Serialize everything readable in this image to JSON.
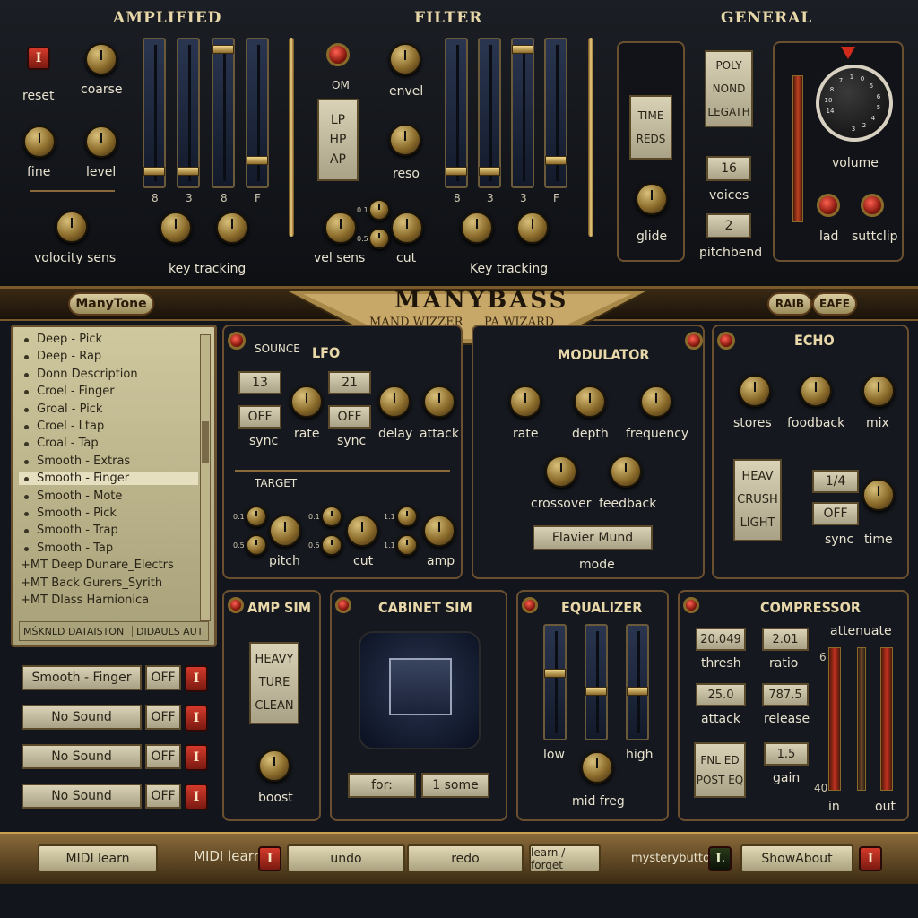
{
  "headers": {
    "amplified": "AMPLIFIED",
    "filter": "FILTER",
    "general": "GENERAL"
  },
  "amplified": {
    "reset": "reset",
    "coarse": "coarse",
    "fine": "fine",
    "level": "level",
    "velocity": "volocity sens",
    "keytracking": "key tracking",
    "s_labels": [
      "8",
      "3",
      "8",
      "F"
    ]
  },
  "filter": {
    "om": "OM",
    "types": [
      "LP",
      "HP",
      "AP"
    ],
    "envel": "envel",
    "reso": "reso",
    "velsens": "vel sens",
    "cut": "cut",
    "keytracking": "Key tracking",
    "s_labels": [
      "8",
      "3",
      "3",
      "F"
    ],
    "mini": [
      "0.1",
      "0.5"
    ]
  },
  "general": {
    "time": "TIME",
    "reds": "REDS",
    "glide": "glide",
    "modes": [
      "POLY",
      "NOND",
      "LEGATH"
    ],
    "voices": "16",
    "voices_label": "voices",
    "pitchbend": "2",
    "pitchbend_label": "pitchbend",
    "volume": "volume",
    "lad": "lad",
    "suttclip": "suttclip",
    "dial_numbers": [
      "14",
      "10",
      "8",
      "7",
      "1",
      "0",
      "5",
      "6",
      "5",
      "4",
      "2",
      "3"
    ]
  },
  "brand": {
    "title": "MANYBASS",
    "sub1": "MAND WIZZER",
    "sub2": "PA WIZARD",
    "left": "ManyTone",
    "right1": "RAIB",
    "right2": "EAFE"
  },
  "presets": {
    "items": [
      "Deep - Pick",
      "Deep - Rap",
      "Donn Description",
      "Croel - Finger",
      "Groal - Pick",
      "Croel - Ltap",
      "Croal - Tap",
      "Smooth - Extras",
      "Smooth - Finger",
      "Smooth - Mote",
      "Smooth - Pick",
      "Smooth - Trap",
      "Smooth - Tap"
    ],
    "folders": [
      "MT Deep Dunare_Electrs",
      "MT Back Gurers_Syrith",
      "MT Dlass Harnionica"
    ],
    "footer_left": "MŚKNLD DATAISTON",
    "footer_right": "DIDAULS AUT"
  },
  "slots": [
    {
      "name": "Smooth - Finger",
      "state": "OFF"
    },
    {
      "name": "No Sound",
      "state": "OFF"
    },
    {
      "name": "No Sound",
      "state": "OFF"
    },
    {
      "name": "No Sound",
      "state": "OFF"
    }
  ],
  "lfo": {
    "sounce": "SOUNCE",
    "title": "LFO",
    "rate_val": "13",
    "sync_val": "OFF",
    "rate": "rate",
    "sync": "sync",
    "delay_val": "21",
    "sync2_val": "OFF",
    "sync2": "sync",
    "delay": "delay",
    "attack": "attack",
    "target": "TARGET",
    "pitch": "pitch",
    "cut": "cut",
    "amp": "amp",
    "minis": [
      "0.1",
      "0.5",
      "0.1",
      "0.5",
      "1.1",
      "1.1"
    ]
  },
  "modulator": {
    "title": "MODULATOR",
    "rate": "rate",
    "depth": "depth",
    "frequency": "frequency",
    "crossover": "crossover",
    "feedback": "feedback",
    "mode_val": "Flavier Mund",
    "mode": "mode"
  },
  "echo": {
    "title": "ECHO",
    "stores": "stores",
    "foodback": "foodback",
    "mix": "mix",
    "types": [
      "HEAV",
      "CRUSH",
      "LIGHT"
    ],
    "time_val": "1/4",
    "sync_val": "OFF",
    "sync": "sync",
    "time": "time"
  },
  "ampsim": {
    "title": "AMP SIM",
    "types": [
      "HEAVY",
      "TURE",
      "CLEAN"
    ],
    "boost": "boost"
  },
  "cabinet": {
    "title": "CABINET SIM",
    "for": "for:",
    "some": "1 some"
  },
  "equalizer": {
    "title": "EQUALIZER",
    "low": "low",
    "high": "high",
    "mid": "mid freg"
  },
  "compressor": {
    "title": "COMPRESSOR",
    "thresh_val": "20.049",
    "thresh": "thresh",
    "ratio_val": "2.01",
    "ratio": "ratio",
    "attenuate": "attenuate",
    "attack_val": "25.0",
    "attack": "attack",
    "release_val": "787.5",
    "release": "release",
    "fnl": "FNL ED",
    "post": "POST EQ",
    "gain_val": "1.5",
    "gain": "gain",
    "top": "6",
    "bottom": "40",
    "in": "in",
    "out": "out"
  },
  "bottom": {
    "midi1": "MIDI learn",
    "midi2": "MIDI learn",
    "undo": "undo",
    "redo": "redo",
    "learn": "learn / forget",
    "mystery": "mysterybutton",
    "mystery_badge": "L",
    "about": "ShowAbout",
    "badge": "I"
  }
}
